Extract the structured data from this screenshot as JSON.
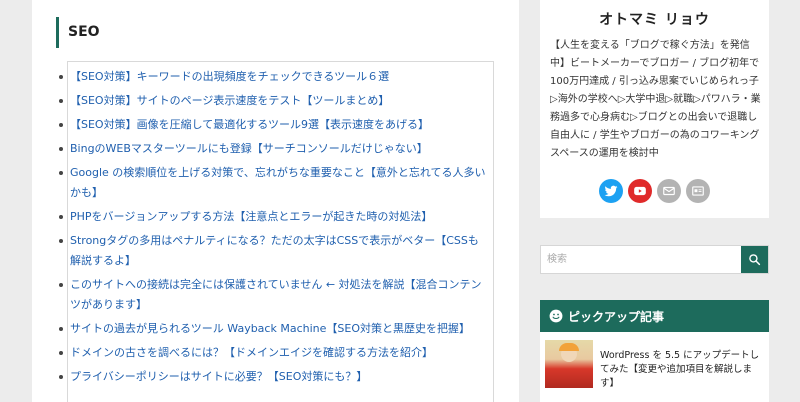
{
  "main": {
    "section_title": "SEO",
    "posts": [
      "【SEO対策】キーワードの出現頻度をチェックできるツール６選",
      "【SEO対策】サイトのページ表示速度をテスト【ツールまとめ】",
      "【SEO対策】画像を圧縮して最適化するツール9選【表示速度をあげる】",
      "BingのWEBマスターツールにも登録【サーチコンソールだけじゃない】",
      "Google の検索順位を上げる対策で、忘れがちな重要なこと【意外と忘れてる人多いかも】",
      "PHPをバージョンアップする方法【注意点とエラーが起きた時の対処法】",
      "Strongタグの多用はペナルティになる？ただの太字はCSSで表示がベター【CSSも解説するよ】",
      "このサイトへの接続は完全には保護されていません ← 対処法を解説【混合コンテンツがあります】",
      "サイトの過去が見られるツール Wayback Machine【SEO対策と黒歴史を把握】",
      "ドメインの古さを調べるには？【ドメインエイジを確認する方法を紹介】",
      "プライバシーポリシーはサイトに必要？【SEO対策にも？】"
    ]
  },
  "sidebar": {
    "profile": {
      "name": "オトマミ リョウ",
      "description": "【人生を変える「ブログで稼ぐ方法」を発信中】ビートメーカーでブロガー / ブログ初年で100万円達成 / 引っ込み思案でいじめられっ子▷海外の学校へ▷大学中退▷就職▷パワハラ・業務過多で心身病む▷ブログとの出会いで退職し自由人に / 学生やブロガーの為のコワーキングスペースの運用を検討中",
      "social": [
        {
          "icon": "twitter-icon",
          "color": "#1da1f2"
        },
        {
          "icon": "youtube-icon",
          "color": "#e02a2a"
        },
        {
          "icon": "mail-icon",
          "color": "#b3b3b3"
        },
        {
          "icon": "feedly-icon",
          "color": "#b3b3b3"
        }
      ]
    },
    "search": {
      "placeholder": "検索",
      "value": ""
    },
    "pickup": {
      "title": "ピックアップ記事",
      "article_title": "WordPress を 5.5 にアップデートしてみた【変更や追加項目を解説します】"
    }
  },
  "colors": {
    "accent": "#1d6b5c",
    "link": "#1f5fae",
    "background": "#ececec"
  }
}
